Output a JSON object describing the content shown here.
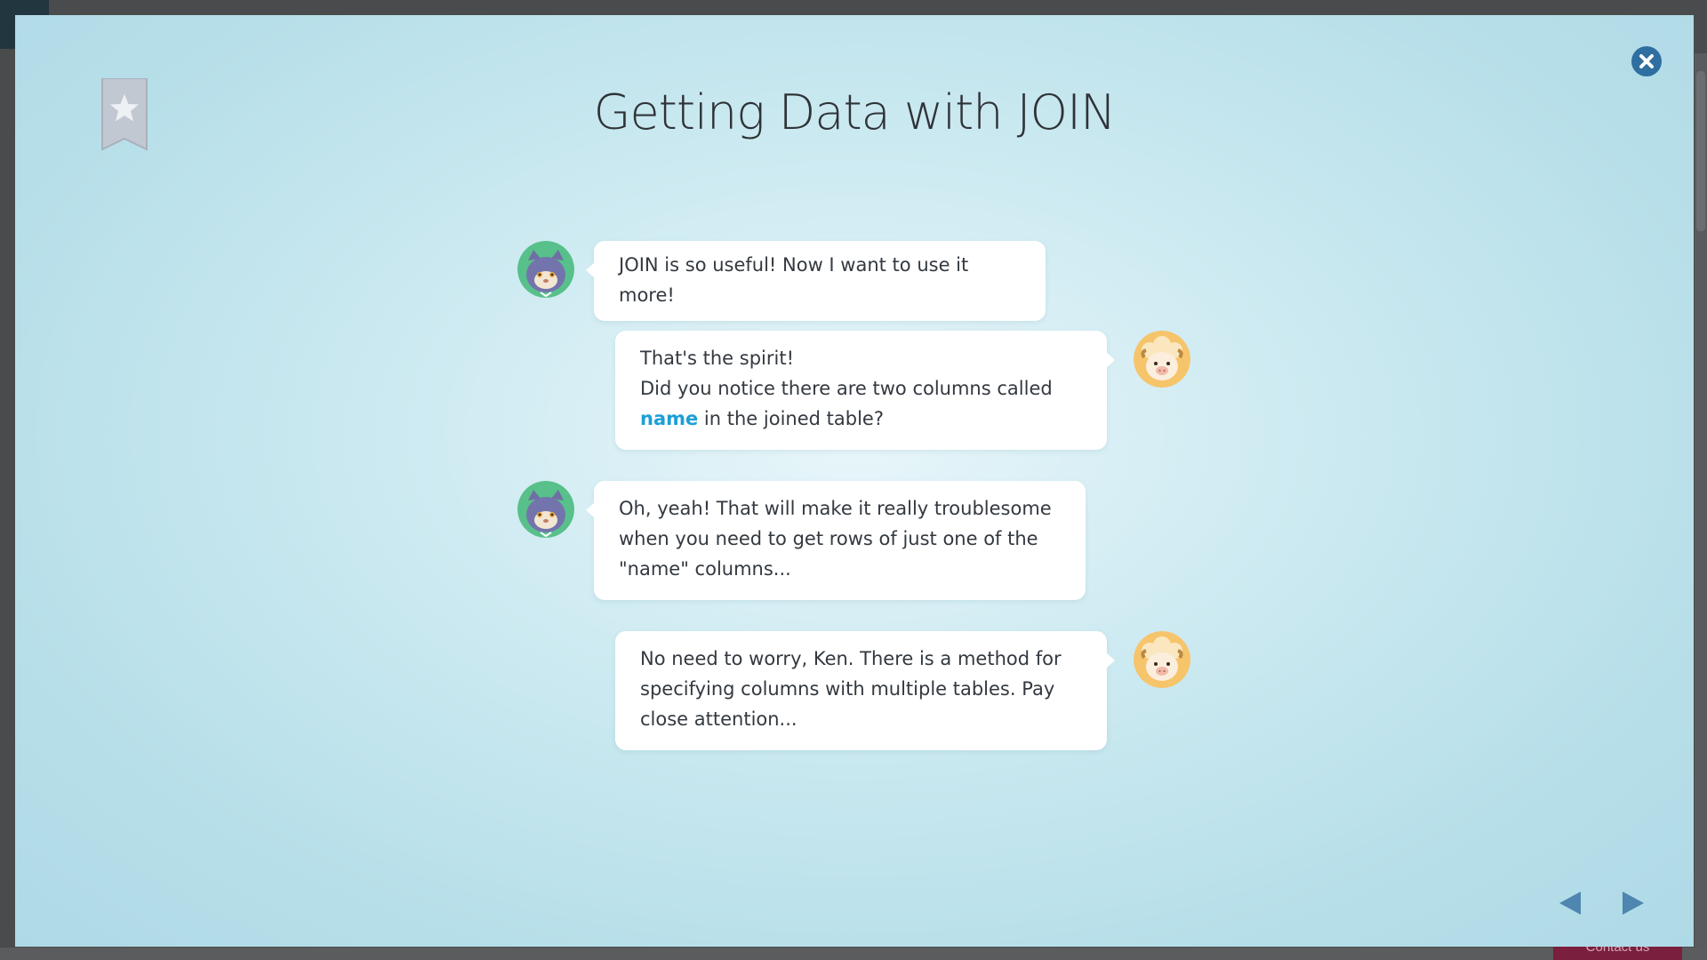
{
  "lesson": {
    "title": "Getting Data with JOIN"
  },
  "controls": {
    "bookmark_icon": "bookmark-star-icon",
    "close_icon": "close-icon",
    "prev_icon": "triangle-left-icon",
    "next_icon": "triangle-right-icon"
  },
  "colors": {
    "accent": "#1b9fd6",
    "close_button": "#2e6ea0",
    "nav_arrow": "#4f86b0",
    "bookmark": "#c0c6cf"
  },
  "messages": [
    {
      "speaker": "ken",
      "avatar_icon": "cat-avatar-icon",
      "lines": [
        "JOIN is so useful! Now I want to use it more!"
      ]
    },
    {
      "speaker": "sheep",
      "avatar_icon": "sheep-avatar-icon",
      "line1": "That's the spirit!",
      "line2": "Did you notice there are two columns called",
      "highlight": "name",
      "line3_rest": " in the joined table?"
    },
    {
      "speaker": "ken",
      "avatar_icon": "cat-avatar-icon",
      "lines": [
        "Oh, yeah! That will make it really troublesome",
        "when you need to get rows of just one of the",
        "\"name\" columns..."
      ]
    },
    {
      "speaker": "sheep",
      "avatar_icon": "sheep-avatar-icon",
      "lines": [
        "No need to worry, Ken. There is a method for",
        "specifying columns with multiple tables. Pay",
        "close attention..."
      ]
    }
  ],
  "background_page": {
    "contact_label": "Contact us"
  }
}
